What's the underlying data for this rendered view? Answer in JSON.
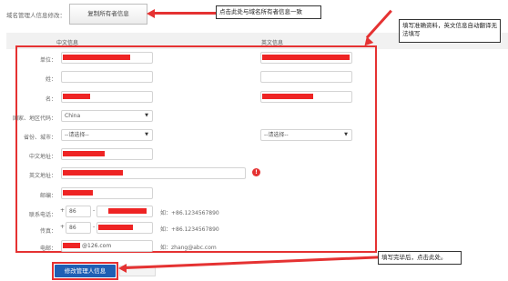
{
  "header": {
    "section_label": "域名管理人信息修改：",
    "copy_button": "复制所有者信息"
  },
  "columns": {
    "cn": "中文信息",
    "en": "英文信息"
  },
  "form": {
    "unit_label": "单位：",
    "surname_label": "姓：",
    "name_label": "名：",
    "country_label": "国家、地区代码：",
    "country_value": "China",
    "province_label": "省份、城市：",
    "province_cn_placeholder": "--请选择--",
    "province_en_placeholder": "--请选择--",
    "cn_address_label": "中文地址：",
    "en_address_label": "英文地址：",
    "warning_glyph": "!",
    "postcode_label": "邮编：",
    "phone_label": "联系电话：",
    "phone_plus": "+",
    "phone_code": "86",
    "phone_dash": "-",
    "phone_hint": "如：+86.1234567890",
    "fax_label": "传真：",
    "fax_plus": "+",
    "fax_code": "86",
    "fax_dash": "-",
    "fax_hint": "如：+86.1234567890",
    "email_label": "电邮：",
    "email_value": "@126.com",
    "email_hint": "如：zhang@abc.com",
    "submit_button": "修改管理人信息"
  },
  "annotations": {
    "copy_note": "点击此处与域名所有者信息一致",
    "fill_note": "填写准确资料，英文信息自动翻译无法填写",
    "submit_note": "填写完毕后，点击此处。"
  },
  "colors": {
    "accent_red": "#e53232",
    "submit_blue": "#1f5fb4"
  }
}
